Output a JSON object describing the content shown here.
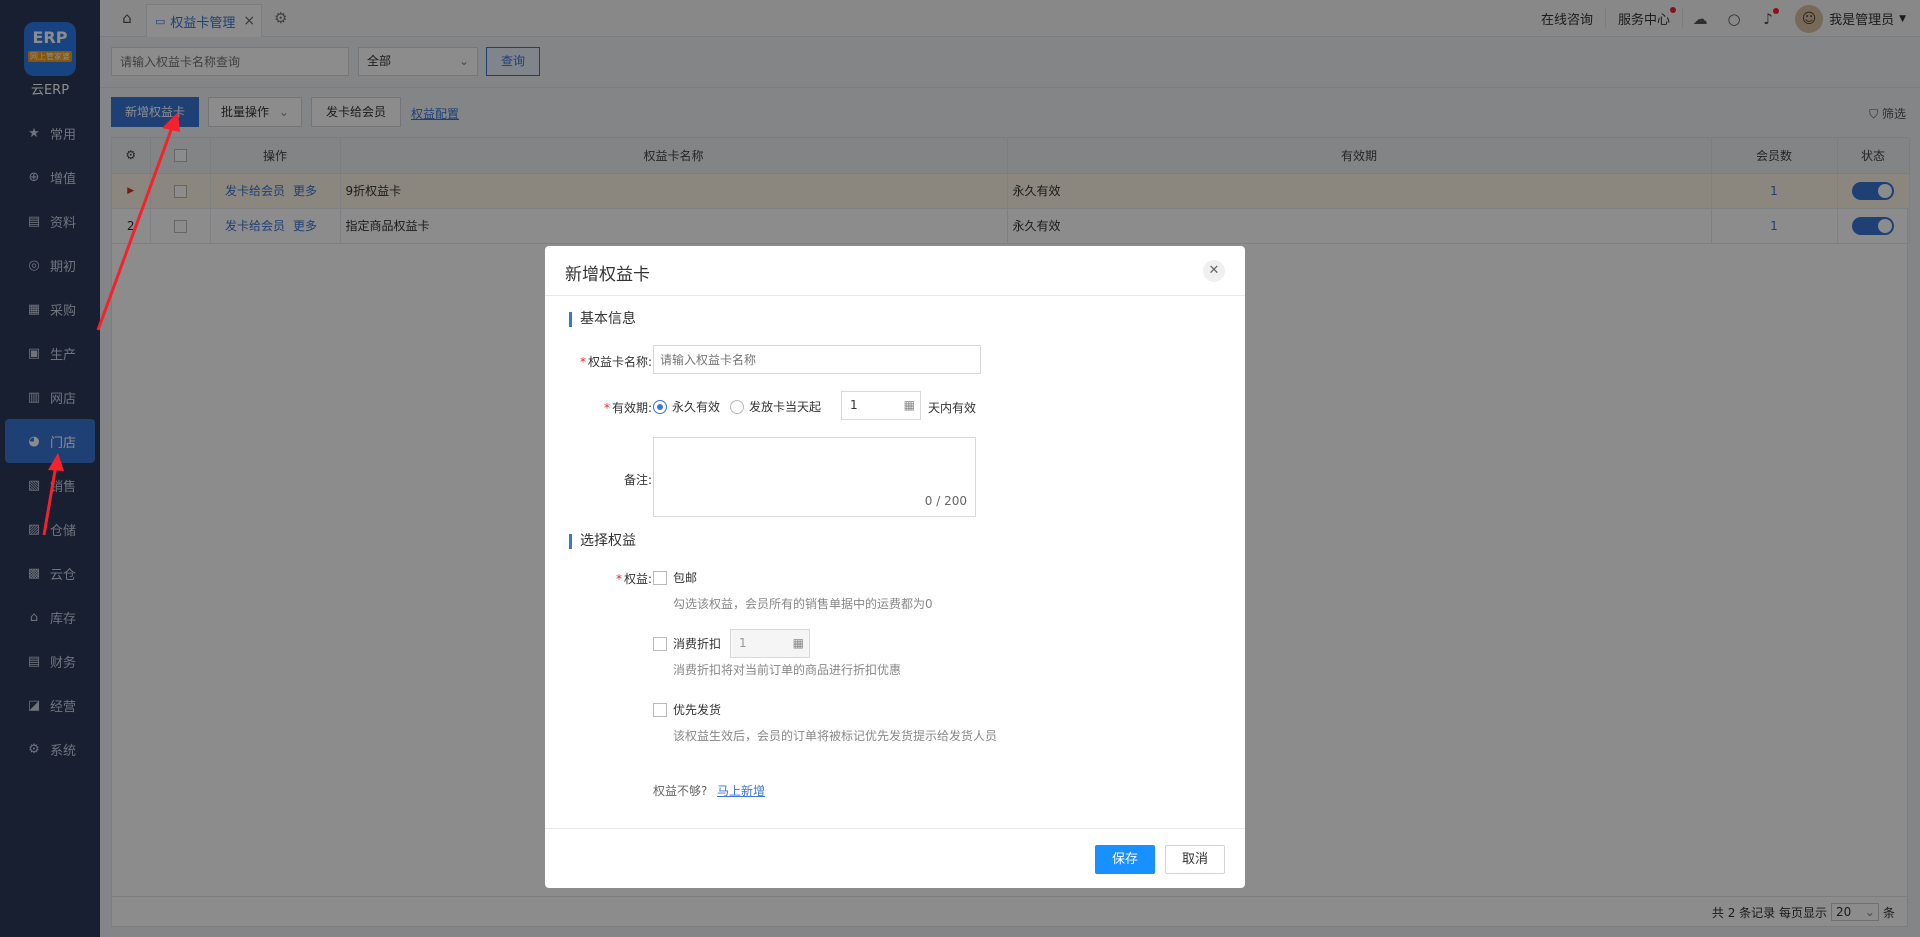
{
  "app": {
    "logo_badge": "ERP",
    "logo_sub": "网上管家婆",
    "logo_text": "云ERP"
  },
  "sidebar": {
    "items": [
      {
        "label": "常用",
        "icon": "star-icon",
        "glyph": "★"
      },
      {
        "label": "增值",
        "icon": "plus-square-icon",
        "glyph": "⊕"
      },
      {
        "label": "资料",
        "icon": "file-icon",
        "glyph": "▤"
      },
      {
        "label": "期初",
        "icon": "disc-icon",
        "glyph": "◎"
      },
      {
        "label": "采购",
        "icon": "cart-icon",
        "glyph": "▦"
      },
      {
        "label": "生产",
        "icon": "box-icon",
        "glyph": "▣"
      },
      {
        "label": "网店",
        "icon": "shop-icon",
        "glyph": "▥"
      },
      {
        "label": "门店",
        "icon": "pie-icon",
        "glyph": "◕",
        "active": true
      },
      {
        "label": "销售",
        "icon": "chart-icon",
        "glyph": "▧"
      },
      {
        "label": "仓储",
        "icon": "warehouse-icon",
        "glyph": "▨"
      },
      {
        "label": "云仓",
        "icon": "cloud-warehouse-icon",
        "glyph": "▩"
      },
      {
        "label": "库存",
        "icon": "home-stock-icon",
        "glyph": "⌂"
      },
      {
        "label": "财务",
        "icon": "finance-icon",
        "glyph": "▤"
      },
      {
        "label": "经营",
        "icon": "trend-icon",
        "glyph": "◪"
      },
      {
        "label": "系统",
        "icon": "settings-icon",
        "glyph": "⚙"
      }
    ]
  },
  "topbar": {
    "tab_label": "权益卡管理",
    "online_consult": "在线咨询",
    "service_center": "服务中心",
    "user_name": "我是管理员"
  },
  "search": {
    "placeholder": "请输入权益卡名称查询",
    "select_value": "全部",
    "query_label": "查询"
  },
  "toolbar": {
    "add_label": "新增权益卡",
    "batch_label": "批量操作",
    "issue_label": "发卡给会员",
    "config_label": "权益配置",
    "filter_label": "筛选"
  },
  "table": {
    "headers": [
      "操作",
      "权益卡名称",
      "有效期",
      "会员数",
      "状态"
    ],
    "rows": [
      {
        "index": "▶",
        "op1": "发卡给会员",
        "op2": "更多",
        "name": "9折权益卡",
        "validity": "永久有效",
        "members": "1"
      },
      {
        "index": "2",
        "op1": "发卡给会员",
        "op2": "更多",
        "name": "指定商品权益卡",
        "validity": "永久有效",
        "members": "1"
      }
    ],
    "footer": {
      "total": "共 2 条记录",
      "per_page_label": "每页显示",
      "page_size": "20",
      "unit": "条"
    }
  },
  "modal": {
    "title": "新增权益卡",
    "section_basic": "基本信息",
    "name_label": "权益卡名称:",
    "name_placeholder": "请输入权益卡名称",
    "validity_label": "有效期:",
    "radio_permanent": "永久有效",
    "radio_from_issue": "发放卡当天起",
    "days_value": "1",
    "days_suffix": "天内有效",
    "remark_label": "备注:",
    "remark_count": "0 / 200",
    "section_rights": "选择权益",
    "rights_label": "权益:",
    "right1_label": "包邮",
    "right1_desc": "勾选该权益，会员所有的销售单据中的运费都为0",
    "right2_label": "消费折扣",
    "right2_value": "1",
    "right2_desc": "消费折扣将对当前订单的商品进行折扣优惠",
    "right3_label": "优先发货",
    "right3_desc": "该权益生效后，会员的订单将被标记优先发货提示给发货人员",
    "not_enough": "权益不够?",
    "add_now": "马上新增",
    "save_label": "保存",
    "cancel_label": "取消"
  },
  "colors": {
    "sidebar_bg": "#2d3a5a",
    "accent": "#3a76d6",
    "save_button": "#1890ff",
    "annotation_arrow": "#f5222d"
  }
}
